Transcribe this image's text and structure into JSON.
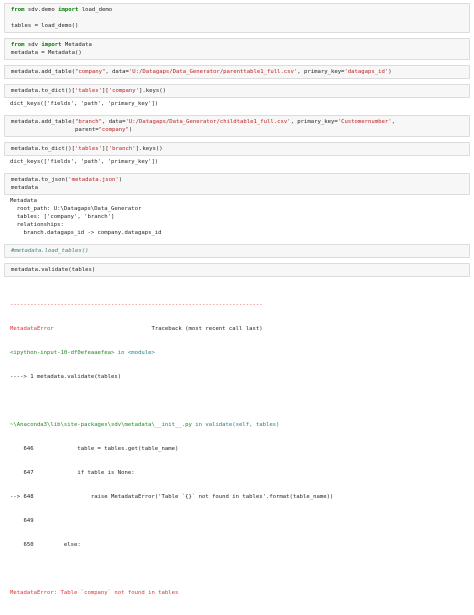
{
  "cells": [
    {
      "code": [
        "from sdv.demo import load_demo",
        "",
        "tables = load_demo()"
      ]
    },
    {
      "code": [
        "from sdv import Metadata",
        "metadata = Metadata()"
      ]
    },
    {
      "code": [
        "metadata.add_table(\"company\", data='U:/Datagaps/Data_Generator/parenttable1_full.csv', primary_key='datagaps_id')"
      ]
    },
    {
      "code": [
        "metadata.to_dict()['tables']['company'].keys()"
      ],
      "output": [
        "dict_keys(['fields', 'path', 'primary_key'])"
      ]
    },
    {
      "code": [
        "metadata.add_table(\"branch\", data='U:/Datagaps/Data_Generator/childtable1_full.csv', primary_key='Customernumber',",
        "                   parent=\"company\")"
      ]
    },
    {
      "code": [
        "metadata.to_dict()['tables']['branch'].keys()"
      ],
      "output": [
        "dict_keys(['fields', 'path', 'primary_key'])"
      ]
    },
    {
      "code": [
        "metadata.to_json('metadata.json')",
        "metadata"
      ],
      "output": [
        "Metadata",
        "  root_path: U:\\Datagaps\\Data_Generator",
        "  tables: ['company', 'branch']",
        "  relationships:",
        "    branch.datagaps_id -> company.datagaps_id"
      ]
    },
    {
      "code": [
        "#metadata.load_tables()"
      ]
    },
    {
      "code": [
        "metadata.validate(tables)"
      ]
    }
  ],
  "traceback": {
    "rule": "---------------------------------------------------------------------------",
    "error_name": "MetadataError",
    "header_right": "Traceback (most recent call last)",
    "input_ref": "<ipython-input-10-df0efeaaefea>",
    "in_module": " in <module>",
    "arrow_line": "----> 1 metadata.validate(tables)",
    "file_path": "~\\Anaconda3\\lib\\site-packages\\sdv\\metadata\\__init__.py",
    "in_func": " in validate(self, tables)",
    "lines": [
      "    646             table = tables.get(table_name)",
      "    647             if table is None:",
      "--> 648                 raise MetadataError('Table `{}` not found in tables'.format(table_name))",
      "    649 ",
      "    650         else:"
    ],
    "final": "MetadataError: Table `company` not found in tables"
  }
}
